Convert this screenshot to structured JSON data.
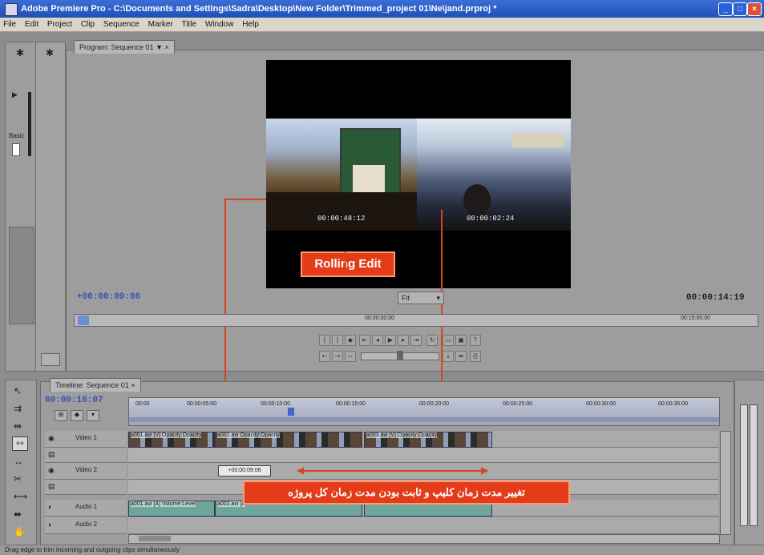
{
  "window": {
    "title": "Adobe Premiere Pro - C:\\Documents and Settings\\Sadra\\Desktop\\New Folder\\Trimmed_project 01\\Ne\\jand.prproj *",
    "minimize": "_",
    "maximize": "□",
    "close": "×"
  },
  "menu": [
    "File",
    "Edit",
    "Project",
    "Clip",
    "Sequence",
    "Marker",
    "Title",
    "Window",
    "Help"
  ],
  "program_monitor": {
    "tab_label": "Program: Sequence 01",
    "tab_menu": "▼ ×",
    "left_clip_timecode": "00:00:48:12",
    "right_clip_timecode": "00:00:02:24",
    "current_time": "+00:00:09:06",
    "fit_label": "Fit",
    "duration": "00:00:14:19",
    "ruler_mid": "00:00:00:00",
    "ruler_right": "00:15:00:00"
  },
  "annotations": {
    "rolling_edit": "Rolling Edit",
    "persian_note": "تغییر مدت زمان کلیپ و ثابت بودن مدت زمان کل پروژه"
  },
  "left_tools": {
    "panel_label": "Basic"
  },
  "timeline": {
    "tab_label": "Timeline: Sequence 01",
    "tab_close": "×",
    "current_time": "00:00:10:07",
    "ruler_ticks": [
      "00:00",
      "00:00:05:00",
      "00:00:10:00",
      "00:00:15:00",
      "00:00:20:00",
      "00:00:25:00",
      "00:00:30:00",
      "00:00:35:00"
    ],
    "tracks": [
      {
        "name": "Video 1"
      },
      {
        "name": "Video 2"
      },
      {
        "name": "Audio 1"
      },
      {
        "name": "Audio 2"
      }
    ],
    "video_clips": [
      {
        "label": "a001.avi [V] Opacity:Opacity"
      },
      {
        "label": "a002.avi Opacity:Opacity"
      },
      {
        "label": "a003.avi [V] Opacity:Opacity"
      }
    ],
    "tooltip_timecode": "+00:00:09:06",
    "audio_clips": [
      {
        "label": "a001.avi [A] Volume:Level"
      },
      {
        "label": "a002.avi [A]"
      },
      {
        "label": ""
      }
    ]
  },
  "status": "Drag edge to trim incoming and outgoing clips simultaneously",
  "colors": {
    "annotation_red": "#e43b19",
    "timecode_blue": "#3a4eb8"
  }
}
